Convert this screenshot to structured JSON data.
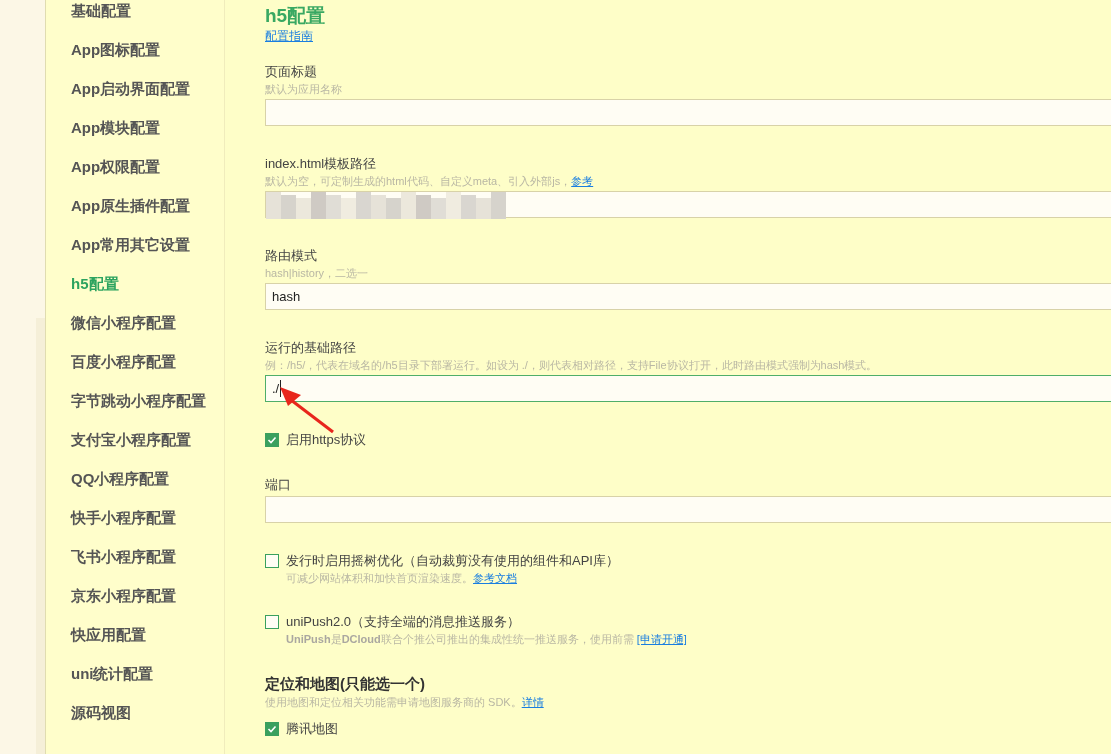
{
  "sidebar": {
    "items": [
      {
        "label": "基础配置",
        "selected": false
      },
      {
        "label": "App图标配置",
        "selected": false
      },
      {
        "label": "App启动界面配置",
        "selected": false
      },
      {
        "label": "App模块配置",
        "selected": false
      },
      {
        "label": "App权限配置",
        "selected": false
      },
      {
        "label": "App原生插件配置",
        "selected": false
      },
      {
        "label": "App常用其它设置",
        "selected": false
      },
      {
        "label": "h5配置",
        "selected": true
      },
      {
        "label": "微信小程序配置",
        "selected": false
      },
      {
        "label": "百度小程序配置",
        "selected": false
      },
      {
        "label": "字节跳动小程序配置",
        "selected": false
      },
      {
        "label": "支付宝小程序配置",
        "selected": false
      },
      {
        "label": "QQ小程序配置",
        "selected": false
      },
      {
        "label": "快手小程序配置",
        "selected": false
      },
      {
        "label": "飞书小程序配置",
        "selected": false
      },
      {
        "label": "京东小程序配置",
        "selected": false
      },
      {
        "label": "快应用配置",
        "selected": false
      },
      {
        "label": "uni统计配置",
        "selected": false
      },
      {
        "label": "源码视图",
        "selected": false
      }
    ]
  },
  "page": {
    "title": "h5配置",
    "guide_link": "配置指南"
  },
  "fields": [
    {
      "kind": "text",
      "label": "页面标题",
      "hint": "默认为应用名称",
      "focused": false
    },
    {
      "kind": "text",
      "label": "index.html模板路径",
      "hint": "默认为空，可定制生成的html代码、自定义meta、引入外部js，",
      "hint_link": "参考",
      "redacted": true,
      "focused": false
    },
    {
      "kind": "text",
      "label": "路由模式",
      "hint": "hash|history，二选一",
      "value": "hash",
      "focused": false
    },
    {
      "kind": "text",
      "label": "运行的基础路径",
      "hint": "例：/h5/，代表在域名的/h5目录下部署运行。如设为 ./，则代表相对路径，支持File协议打开，此时路由模式强制为hash模式。",
      "value": "./",
      "focused": true,
      "annotated": true
    },
    {
      "kind": "checkbox",
      "label": "启用https协议",
      "checked": true
    },
    {
      "kind": "text",
      "label": "端口",
      "focused": false
    },
    {
      "kind": "checkbox",
      "label": "发行时启用摇树优化（自动裁剪没有使用的组件和API库）",
      "checked": false,
      "hint": "可减少网站体积和加快首页渲染速度。",
      "hint_link": "参考文档"
    },
    {
      "kind": "checkbox",
      "label": "uniPush2.0（支持全端的消息推送服务）",
      "checked": false,
      "hint": "**UniPush**是**DCloud**联合个推公司推出的集成性统一推送服务，使用前需 ",
      "hint_link": "[申请开通]"
    },
    {
      "kind": "section",
      "label": "定位和地图(只能选一个)",
      "hint": "使用地图和定位相关功能需申请地图服务商的 SDK。",
      "hint_link": "详情"
    },
    {
      "kind": "checkbox",
      "label": "腾讯地图",
      "checked": true
    }
  ]
}
